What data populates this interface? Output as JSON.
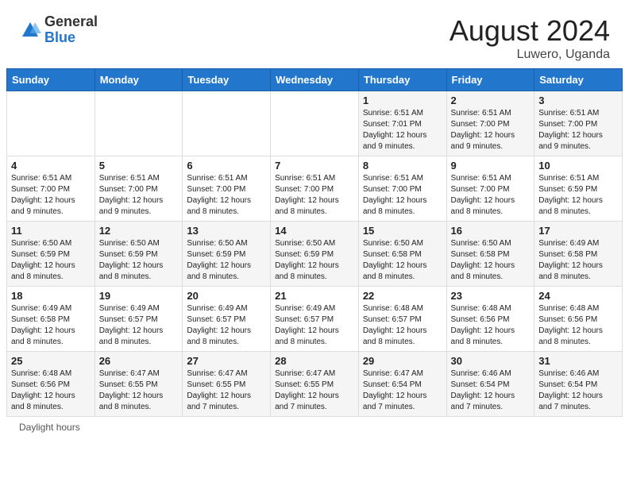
{
  "header": {
    "logo_general": "General",
    "logo_blue": "Blue",
    "month_year": "August 2024",
    "location": "Luwero, Uganda"
  },
  "days_of_week": [
    "Sunday",
    "Monday",
    "Tuesday",
    "Wednesday",
    "Thursday",
    "Friday",
    "Saturday"
  ],
  "footer": {
    "daylight_hours": "Daylight hours"
  },
  "weeks": [
    {
      "days": [
        {
          "num": "",
          "info": ""
        },
        {
          "num": "",
          "info": ""
        },
        {
          "num": "",
          "info": ""
        },
        {
          "num": "",
          "info": ""
        },
        {
          "num": "1",
          "info": "Sunrise: 6:51 AM\nSunset: 7:01 PM\nDaylight: 12 hours and 9 minutes."
        },
        {
          "num": "2",
          "info": "Sunrise: 6:51 AM\nSunset: 7:00 PM\nDaylight: 12 hours and 9 minutes."
        },
        {
          "num": "3",
          "info": "Sunrise: 6:51 AM\nSunset: 7:00 PM\nDaylight: 12 hours and 9 minutes."
        }
      ]
    },
    {
      "days": [
        {
          "num": "4",
          "info": "Sunrise: 6:51 AM\nSunset: 7:00 PM\nDaylight: 12 hours and 9 minutes."
        },
        {
          "num": "5",
          "info": "Sunrise: 6:51 AM\nSunset: 7:00 PM\nDaylight: 12 hours and 9 minutes."
        },
        {
          "num": "6",
          "info": "Sunrise: 6:51 AM\nSunset: 7:00 PM\nDaylight: 12 hours and 8 minutes."
        },
        {
          "num": "7",
          "info": "Sunrise: 6:51 AM\nSunset: 7:00 PM\nDaylight: 12 hours and 8 minutes."
        },
        {
          "num": "8",
          "info": "Sunrise: 6:51 AM\nSunset: 7:00 PM\nDaylight: 12 hours and 8 minutes."
        },
        {
          "num": "9",
          "info": "Sunrise: 6:51 AM\nSunset: 7:00 PM\nDaylight: 12 hours and 8 minutes."
        },
        {
          "num": "10",
          "info": "Sunrise: 6:51 AM\nSunset: 6:59 PM\nDaylight: 12 hours and 8 minutes."
        }
      ]
    },
    {
      "days": [
        {
          "num": "11",
          "info": "Sunrise: 6:50 AM\nSunset: 6:59 PM\nDaylight: 12 hours and 8 minutes."
        },
        {
          "num": "12",
          "info": "Sunrise: 6:50 AM\nSunset: 6:59 PM\nDaylight: 12 hours and 8 minutes."
        },
        {
          "num": "13",
          "info": "Sunrise: 6:50 AM\nSunset: 6:59 PM\nDaylight: 12 hours and 8 minutes."
        },
        {
          "num": "14",
          "info": "Sunrise: 6:50 AM\nSunset: 6:59 PM\nDaylight: 12 hours and 8 minutes."
        },
        {
          "num": "15",
          "info": "Sunrise: 6:50 AM\nSunset: 6:58 PM\nDaylight: 12 hours and 8 minutes."
        },
        {
          "num": "16",
          "info": "Sunrise: 6:50 AM\nSunset: 6:58 PM\nDaylight: 12 hours and 8 minutes."
        },
        {
          "num": "17",
          "info": "Sunrise: 6:49 AM\nSunset: 6:58 PM\nDaylight: 12 hours and 8 minutes."
        }
      ]
    },
    {
      "days": [
        {
          "num": "18",
          "info": "Sunrise: 6:49 AM\nSunset: 6:58 PM\nDaylight: 12 hours and 8 minutes."
        },
        {
          "num": "19",
          "info": "Sunrise: 6:49 AM\nSunset: 6:57 PM\nDaylight: 12 hours and 8 minutes."
        },
        {
          "num": "20",
          "info": "Sunrise: 6:49 AM\nSunset: 6:57 PM\nDaylight: 12 hours and 8 minutes."
        },
        {
          "num": "21",
          "info": "Sunrise: 6:49 AM\nSunset: 6:57 PM\nDaylight: 12 hours and 8 minutes."
        },
        {
          "num": "22",
          "info": "Sunrise: 6:48 AM\nSunset: 6:57 PM\nDaylight: 12 hours and 8 minutes."
        },
        {
          "num": "23",
          "info": "Sunrise: 6:48 AM\nSunset: 6:56 PM\nDaylight: 12 hours and 8 minutes."
        },
        {
          "num": "24",
          "info": "Sunrise: 6:48 AM\nSunset: 6:56 PM\nDaylight: 12 hours and 8 minutes."
        }
      ]
    },
    {
      "days": [
        {
          "num": "25",
          "info": "Sunrise: 6:48 AM\nSunset: 6:56 PM\nDaylight: 12 hours and 8 minutes."
        },
        {
          "num": "26",
          "info": "Sunrise: 6:47 AM\nSunset: 6:55 PM\nDaylight: 12 hours and 8 minutes."
        },
        {
          "num": "27",
          "info": "Sunrise: 6:47 AM\nSunset: 6:55 PM\nDaylight: 12 hours and 7 minutes."
        },
        {
          "num": "28",
          "info": "Sunrise: 6:47 AM\nSunset: 6:55 PM\nDaylight: 12 hours and 7 minutes."
        },
        {
          "num": "29",
          "info": "Sunrise: 6:47 AM\nSunset: 6:54 PM\nDaylight: 12 hours and 7 minutes."
        },
        {
          "num": "30",
          "info": "Sunrise: 6:46 AM\nSunset: 6:54 PM\nDaylight: 12 hours and 7 minutes."
        },
        {
          "num": "31",
          "info": "Sunrise: 6:46 AM\nSunset: 6:54 PM\nDaylight: 12 hours and 7 minutes."
        }
      ]
    }
  ]
}
